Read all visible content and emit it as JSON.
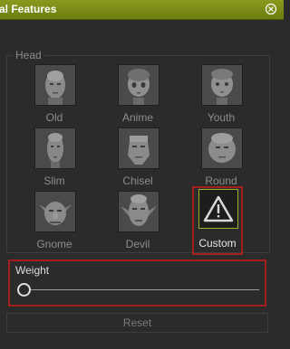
{
  "window": {
    "title": "al Features"
  },
  "head_group": {
    "legend": "Head",
    "presets": [
      {
        "label": "Old",
        "icon": "face-old-icon"
      },
      {
        "label": "Anime",
        "icon": "face-anime-icon"
      },
      {
        "label": "Youth",
        "icon": "face-youth-icon"
      },
      {
        "label": "Slim",
        "icon": "face-slim-icon"
      },
      {
        "label": "Chisel",
        "icon": "face-chisel-icon"
      },
      {
        "label": "Round",
        "icon": "face-round-icon"
      },
      {
        "label": "Gnome",
        "icon": "face-gnome-icon"
      },
      {
        "label": "Devil",
        "icon": "face-devil-icon"
      },
      {
        "label": "Custom",
        "icon": "warning-triangle-icon",
        "selected": true
      }
    ]
  },
  "weight": {
    "label": "Weight",
    "value": 0
  },
  "reset_label": "Reset",
  "colors": {
    "title_bar": "#7a8a18",
    "selection_border": "#a41e1e",
    "background": "#2b2b2b"
  }
}
